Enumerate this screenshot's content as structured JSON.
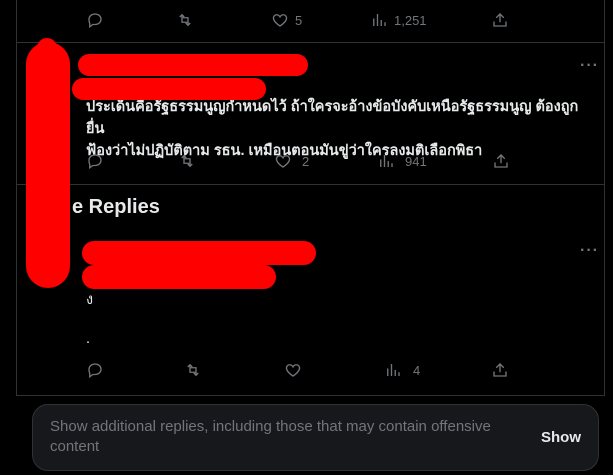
{
  "top_actions": {
    "reply_count": "",
    "retweet_count": "",
    "like_count": "5",
    "views_count": "1,251"
  },
  "tweet1": {
    "text": "ประเด็นคือรัฐธรรมนูญกำหนดไว้ ถ้าใครจะอ้างข้อบังคับเหนือรัฐธรรมนูญ ต้องถูกยื่น\nฟ้องว่าไม่ปฏิบัติตาม รธน. เหมือนตอนมันขู่ว่าใครลงมติเลือกพิธา",
    "more": "···",
    "actions": {
      "reply_count": "",
      "retweet_count": "",
      "like_count": "2",
      "views_count": "941"
    }
  },
  "section": {
    "title": "e Replies"
  },
  "tweet2": {
    "line1": "ง",
    "line2": ".",
    "more": "···",
    "actions": {
      "reply_count": "",
      "retweet_count": "",
      "like_count": "",
      "views_count": "4"
    }
  },
  "show_more": {
    "text": "Show additional replies, including those that may contain offensive content",
    "button": "Show"
  },
  "colors": {
    "background": "#000000",
    "text": "#e7e9ea",
    "muted": "#71767b",
    "redaction": "#ff0000"
  }
}
